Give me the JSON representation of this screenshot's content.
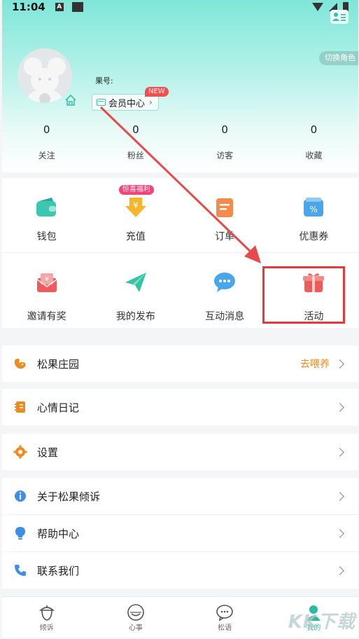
{
  "status_bar": {
    "time": "11:04",
    "a_glyph": "A"
  },
  "header": {
    "switch_role": "切换角色",
    "guo_label": "果号:",
    "member_center": "会员中心",
    "new_badge": "NEW",
    "stats": [
      {
        "value": "0",
        "label": "关注"
      },
      {
        "value": "0",
        "label": "粉丝"
      },
      {
        "value": "0",
        "label": "访客"
      },
      {
        "value": "0",
        "label": "收藏"
      }
    ]
  },
  "grid": {
    "row1": [
      {
        "label": "钱包",
        "icon": "wallet-icon",
        "color": "#3ec7b0"
      },
      {
        "label": "充值",
        "icon": "recharge-icon",
        "color": "#f7b52b",
        "badge": "惊喜福利"
      },
      {
        "label": "订单",
        "icon": "order-icon",
        "color": "#f48a4b"
      },
      {
        "label": "优惠券",
        "icon": "coupon-icon",
        "color": "#4aa6ea"
      }
    ],
    "row2": [
      {
        "label": "邀请有奖",
        "icon": "invite-icon",
        "color": "#ef5a5a"
      },
      {
        "label": "我的发布",
        "icon": "paper-plane-icon",
        "color": "#33c4a4"
      },
      {
        "label": "互动消息",
        "icon": "chat-bubble-icon",
        "color": "#4aa6ea"
      },
      {
        "label": "活动",
        "icon": "gift-icon",
        "color": "#ef5a5a"
      }
    ]
  },
  "list": [
    {
      "label": "松果庄园",
      "extra": "去喂养",
      "icon": "squirrel-icon",
      "color": "#f08a1a"
    },
    {
      "label": "心情日记",
      "icon": "diary-icon",
      "color": "#f08a1a"
    },
    {
      "label": "设置",
      "icon": "gear-icon",
      "color": "#f08a1a"
    },
    {
      "label": "关于松果倾诉",
      "icon": "info-icon",
      "color": "#3d8ee6"
    },
    {
      "label": "帮助中心",
      "icon": "lightbulb-icon",
      "color": "#3d8ee6"
    },
    {
      "label": "联系我们",
      "icon": "phone-icon",
      "color": "#3d8ee6"
    }
  ],
  "bottom_nav": [
    {
      "label": "倾诉",
      "icon": "acorn-icon"
    },
    {
      "label": "心事",
      "icon": "face-icon"
    },
    {
      "label": "松语",
      "icon": "chat-icon"
    },
    {
      "label": "我的",
      "icon": "profile-icon",
      "active": true
    }
  ],
  "watermark": "KK下载"
}
